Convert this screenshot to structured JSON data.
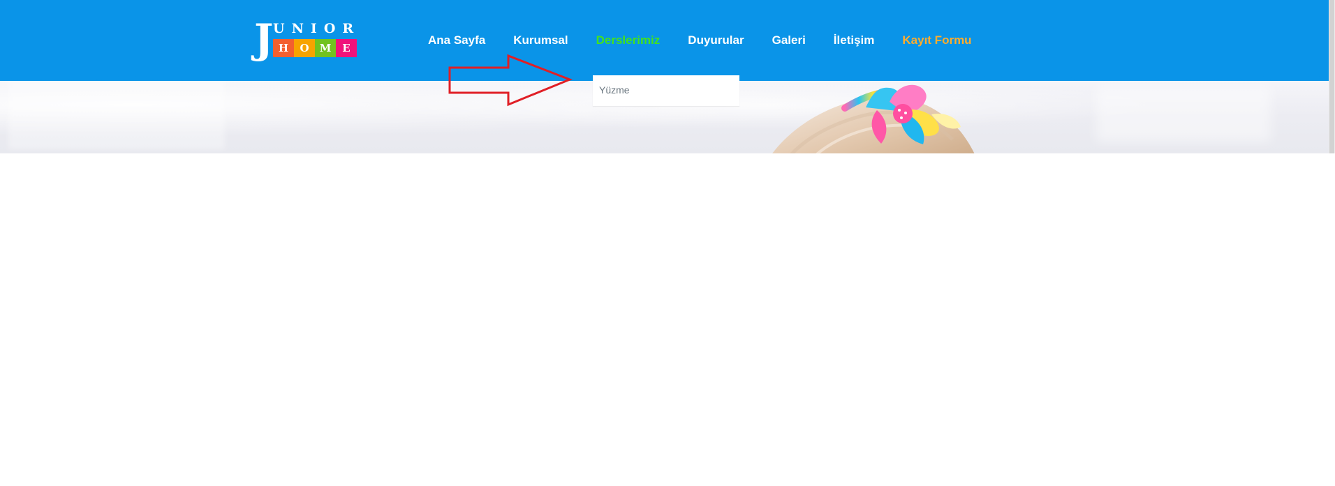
{
  "logo": {
    "top_text": "UNIOR",
    "initial": "J",
    "blocks": [
      "H",
      "O",
      "M",
      "E"
    ]
  },
  "nav": {
    "items": [
      {
        "label": "Ana Sayfa",
        "state": "normal"
      },
      {
        "label": "Kurumsal",
        "state": "normal"
      },
      {
        "label": "Derslerimiz",
        "state": "active"
      },
      {
        "label": "Duyurular",
        "state": "normal"
      },
      {
        "label": "Galeri",
        "state": "normal"
      },
      {
        "label": "İletişim",
        "state": "normal"
      },
      {
        "label": "Kayıt Formu",
        "state": "highlight"
      }
    ]
  },
  "dropdown": {
    "items": [
      {
        "label": "Yüzme"
      }
    ]
  },
  "colors": {
    "header": "#0a94e8",
    "active_nav": "#42e21e",
    "signup_nav": "#ffad2d",
    "arrow": "#e01f26",
    "dropdown_text": "#6b7780"
  },
  "icons": {
    "annotation": "right-arrow-icon"
  }
}
